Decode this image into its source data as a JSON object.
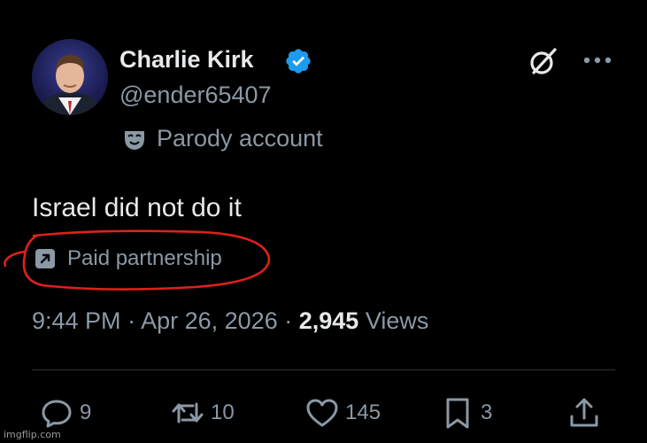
{
  "author": {
    "display_name": "Charlie Kirk",
    "handle": "@ender65407",
    "label": "Parody account",
    "verified": true
  },
  "tweet": {
    "text": "Israel did not do it",
    "paid_label": "Paid partnership",
    "time": "9:44 PM",
    "date": "Apr 26, 2026",
    "views_count": "2,945",
    "views_label": "Views"
  },
  "actions": {
    "replies": "9",
    "reposts": "10",
    "likes": "145",
    "bookmarks": "3"
  },
  "watermark": "imgflip.com",
  "colors": {
    "background": "#000000",
    "text": "#e7e9ea",
    "muted": "#8b98a5",
    "verified": "#1d9bf0",
    "annotation": "#e0201b"
  },
  "icons": {
    "verified": "verified-badge-icon",
    "parody": "mask-icon",
    "grok": "grok-icon",
    "more": "more-horizontal-icon",
    "paid": "arrow-up-right-box-icon",
    "reply": "reply-bubble-icon",
    "repost": "repost-icon",
    "like": "heart-icon",
    "bookmark": "bookmark-icon",
    "share": "share-icon"
  }
}
